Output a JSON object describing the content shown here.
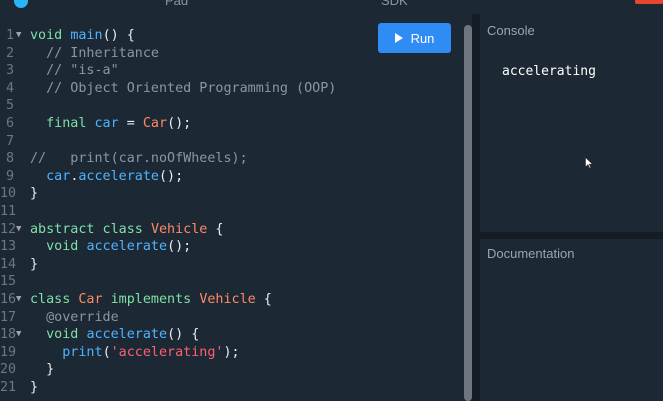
{
  "topbar": {
    "tab_pad": "Pad",
    "tab_sdk": "SDK"
  },
  "editor": {
    "run_label": "Run",
    "lines": [
      {
        "n": "1",
        "fold": true
      },
      {
        "n": "2",
        "fold": false
      },
      {
        "n": "3",
        "fold": false
      },
      {
        "n": "4",
        "fold": false
      },
      {
        "n": "5",
        "fold": false
      },
      {
        "n": "6",
        "fold": false
      },
      {
        "n": "7",
        "fold": false
      },
      {
        "n": "8",
        "fold": false
      },
      {
        "n": "9",
        "fold": false
      },
      {
        "n": "10",
        "fold": false
      },
      {
        "n": "11",
        "fold": false
      },
      {
        "n": "12",
        "fold": true
      },
      {
        "n": "13",
        "fold": false
      },
      {
        "n": "14",
        "fold": false
      },
      {
        "n": "15",
        "fold": false
      },
      {
        "n": "16",
        "fold": true
      },
      {
        "n": "17",
        "fold": false
      },
      {
        "n": "18",
        "fold": true
      },
      {
        "n": "19",
        "fold": false
      },
      {
        "n": "20",
        "fold": false
      },
      {
        "n": "21",
        "fold": false
      }
    ],
    "code": [
      [
        [
          "kw",
          "void "
        ],
        [
          "fn",
          "main"
        ],
        [
          "pl",
          "() {"
        ]
      ],
      [
        [
          "cm",
          "  // Inheritance"
        ]
      ],
      [
        [
          "cm",
          "  // \"is-a\""
        ]
      ],
      [
        [
          "cm",
          "  // Object Oriented Programming (OOP)"
        ]
      ],
      [],
      [
        [
          "kw",
          "  final "
        ],
        [
          "id",
          "car"
        ],
        [
          "pl",
          " = "
        ],
        [
          "cls",
          "Car"
        ],
        [
          "pl",
          "();"
        ]
      ],
      [],
      [
        [
          "cm",
          "//   print(car.noOfWheels);"
        ]
      ],
      [
        [
          "id",
          "  car"
        ],
        [
          "pl",
          "."
        ],
        [
          "fn",
          "accelerate"
        ],
        [
          "pl",
          "();"
        ]
      ],
      [
        [
          "pl",
          "}"
        ]
      ],
      [],
      [
        [
          "kw",
          "abstract class "
        ],
        [
          "cls",
          "Vehicle"
        ],
        [
          "pl",
          " {"
        ]
      ],
      [
        [
          "kw",
          "  void "
        ],
        [
          "fn",
          "accelerate"
        ],
        [
          "pl",
          "();"
        ]
      ],
      [
        [
          "pl",
          "}"
        ]
      ],
      [],
      [
        [
          "kw",
          "class "
        ],
        [
          "cls",
          "Car"
        ],
        [
          "kw",
          " implements "
        ],
        [
          "cls",
          "Vehicle"
        ],
        [
          "pl",
          " {"
        ]
      ],
      [
        [
          "ann",
          "  @override"
        ]
      ],
      [
        [
          "kw",
          "  void "
        ],
        [
          "fn",
          "accelerate"
        ],
        [
          "pl",
          "() {"
        ]
      ],
      [
        [
          "fn",
          "    print"
        ],
        [
          "pl",
          "("
        ],
        [
          "str",
          "'accelerating'"
        ],
        [
          "pl",
          ");"
        ]
      ],
      [
        [
          "pl",
          "  }"
        ]
      ],
      [
        [
          "pl",
          "}"
        ]
      ]
    ]
  },
  "console": {
    "title": "Console",
    "output": "accelerating"
  },
  "documentation": {
    "title": "Documentation"
  }
}
